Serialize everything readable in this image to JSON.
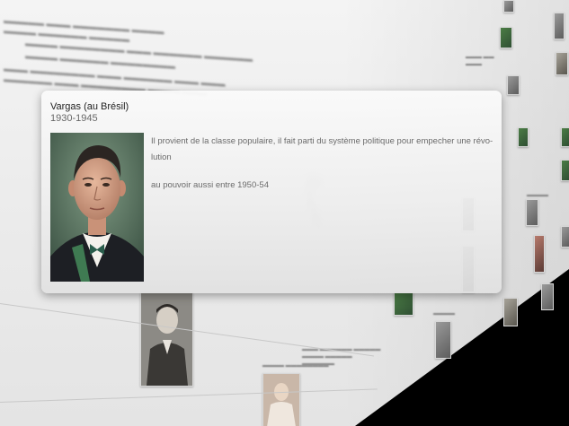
{
  "popup": {
    "title": "Vargas (au Brésil)",
    "dates": "1930-1945",
    "description": "Il provient de la classe populaire, il fait parti du système politique pour empecher une révo-lution",
    "note": "au pouvoir aussi entre 1950-54"
  },
  "icons": {
    "portrait": "portrait-image"
  },
  "colors": {
    "popup_background": "#f0f0f0",
    "popup_text": "#6b6b6b",
    "title_text": "#222222"
  }
}
